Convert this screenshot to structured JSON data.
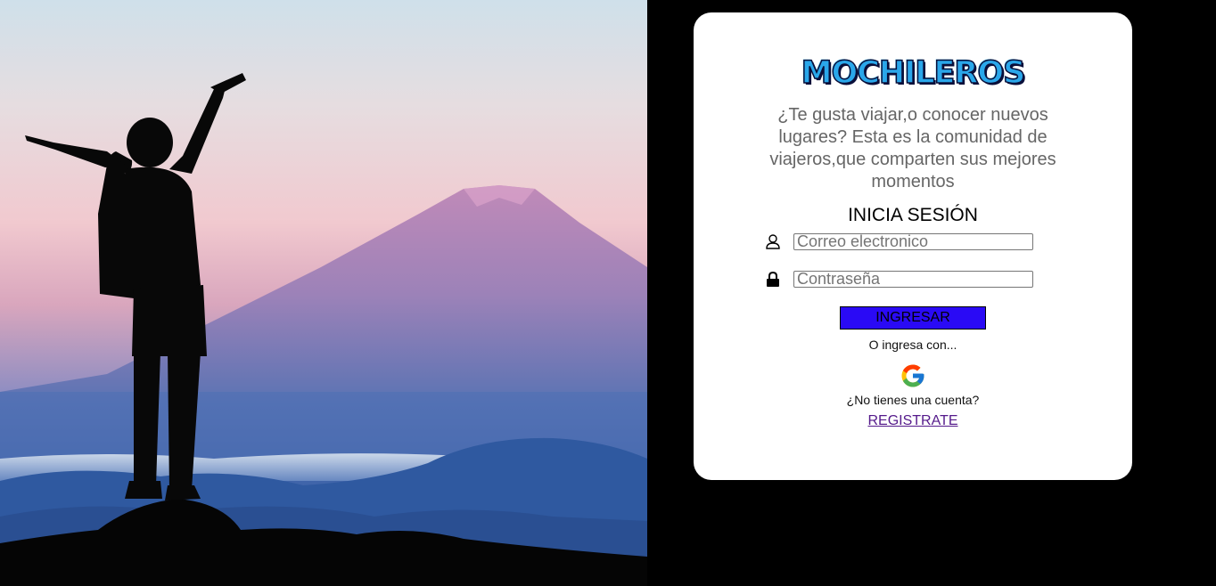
{
  "hero": {
    "image": "hiker-silhouette-mountain-sunset"
  },
  "card": {
    "logo_text": "MOCHILEROS",
    "tagline": "¿Te gusta viajar,o conocer nuevos lugares? Esta es la comunidad de viajeros,que comparten sus mejores momentos",
    "login_title": "INICIA SESIÓN",
    "email": {
      "icon": "user-icon",
      "placeholder": "Correo electronico",
      "value": ""
    },
    "password": {
      "icon": "lock-icon",
      "placeholder": "Contraseña",
      "value": ""
    },
    "login_button": "INGRESAR",
    "alt_login_text": "O ingresa con...",
    "google_icon": "google-icon",
    "no_account_text": "¿No tienes una cuenta?",
    "register_link": "REGISTRATE"
  },
  "colors": {
    "background": "#000000",
    "card": "#ffffff",
    "button": "#2a0af5",
    "link": "#551a8b",
    "logo": "#2aa7ea"
  }
}
